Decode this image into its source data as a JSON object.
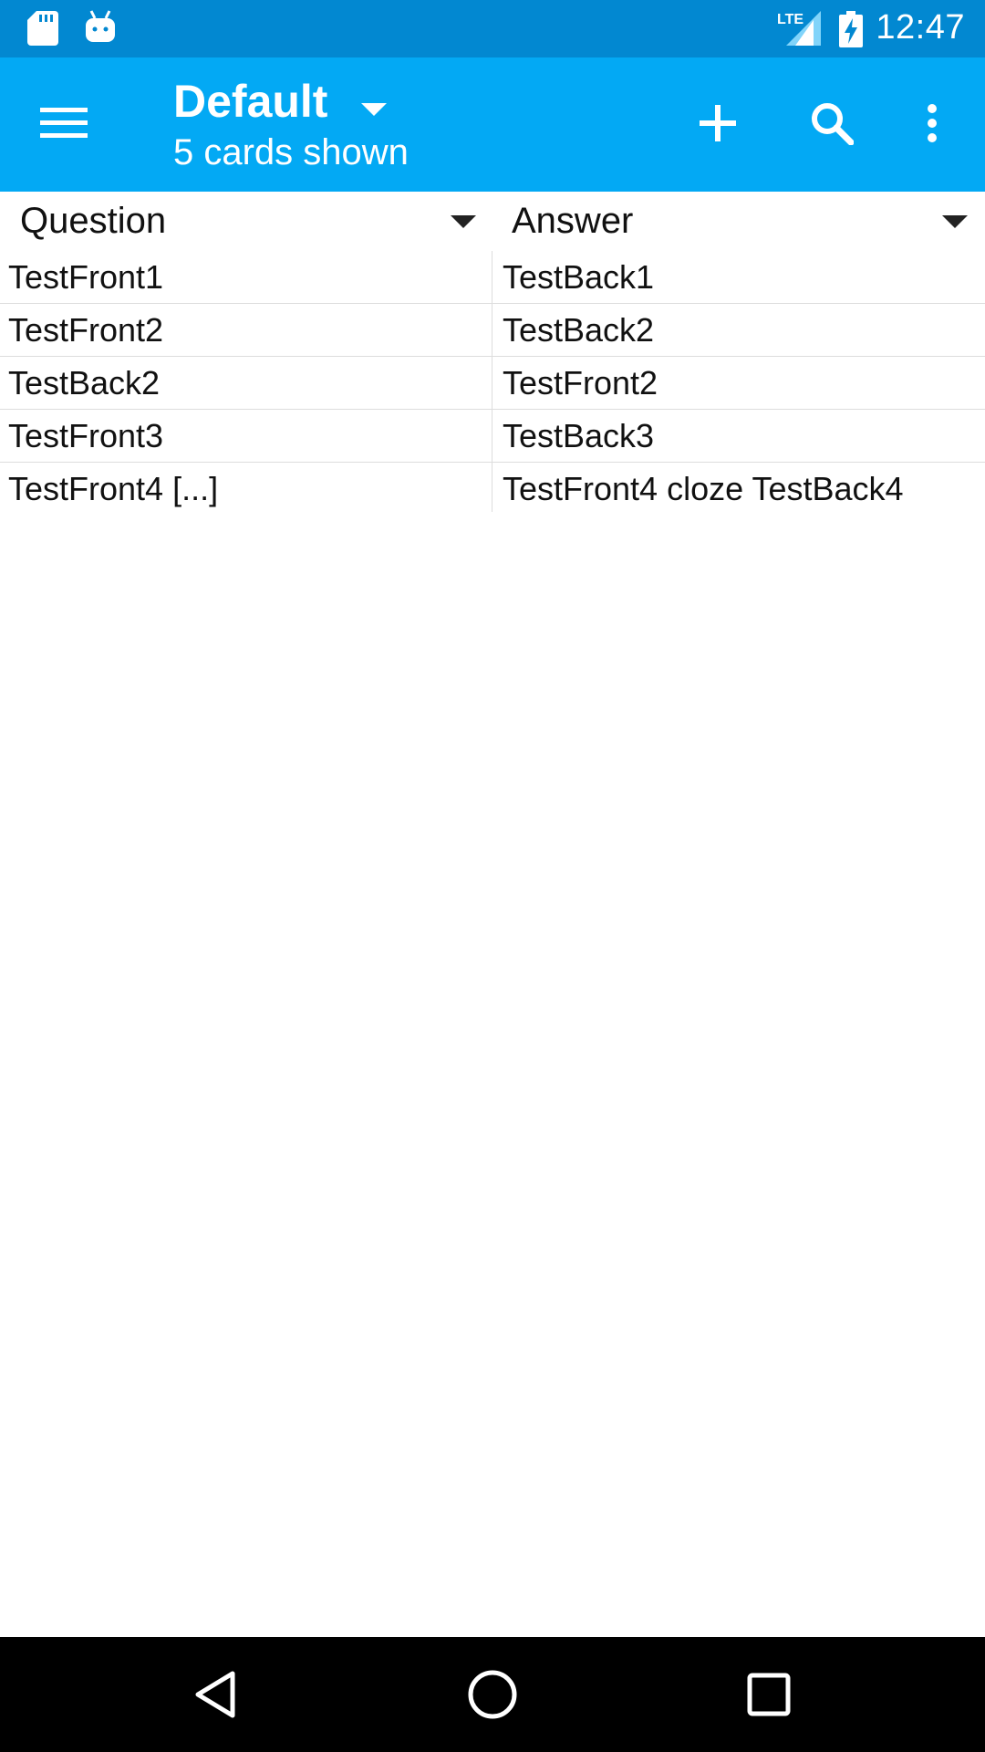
{
  "status_bar": {
    "time": "12:47",
    "network": "LTE",
    "icons": [
      "sd-card-icon",
      "android-icon",
      "signal-icon",
      "battery-charging-icon"
    ]
  },
  "toolbar": {
    "title": "Default",
    "subtitle": "5 cards shown",
    "icons": [
      "menu-icon",
      "dropdown-arrow-icon",
      "add-icon",
      "search-icon",
      "overflow-menu-icon"
    ]
  },
  "columns": {
    "question": "Question",
    "answer": "Answer"
  },
  "cards": [
    {
      "question": "TestFront1",
      "answer": "TestBack1"
    },
    {
      "question": "TestFront2",
      "answer": "TestBack2"
    },
    {
      "question": "TestBack2",
      "answer": "TestFront2"
    },
    {
      "question": "TestFront3",
      "answer": "TestBack3"
    },
    {
      "question": "TestFront4 [...]",
      "answer": "TestFront4 cloze  TestBack4"
    }
  ],
  "nav_bar": {
    "icons": [
      "back-icon",
      "home-icon",
      "recents-icon"
    ]
  },
  "colors": {
    "status_bar": "#0288d1",
    "toolbar": "#03a9f4",
    "nav_bar": "#000000"
  }
}
